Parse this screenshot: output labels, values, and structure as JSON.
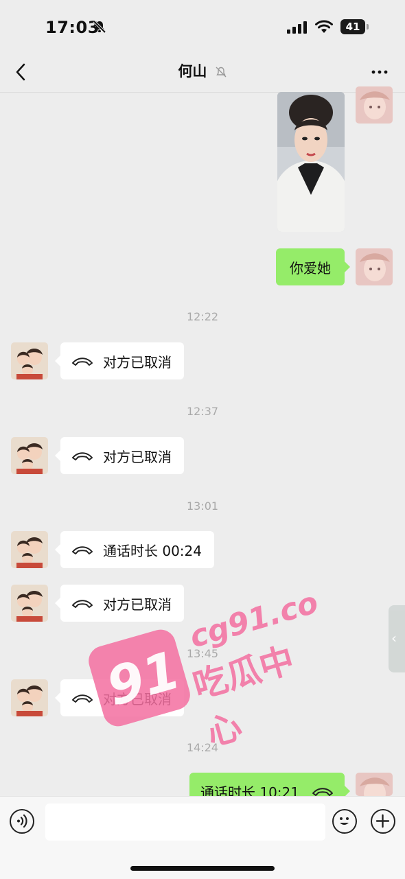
{
  "status_bar": {
    "time": "17:03",
    "battery": "41"
  },
  "header": {
    "title": "何山"
  },
  "messages": [
    {
      "side": "right",
      "type": "image"
    },
    {
      "side": "right",
      "type": "text",
      "text": "你爱她"
    },
    {
      "type": "timestamp",
      "text": "12:22"
    },
    {
      "side": "left",
      "type": "call",
      "text": "对方已取消"
    },
    {
      "type": "timestamp",
      "text": "12:37"
    },
    {
      "side": "left",
      "type": "call",
      "text": "对方已取消"
    },
    {
      "type": "timestamp",
      "text": "13:01"
    },
    {
      "side": "left",
      "type": "call",
      "text": "通话时长 00:24"
    },
    {
      "side": "left",
      "type": "call",
      "text": "对方已取消"
    },
    {
      "type": "timestamp",
      "text": "13:45"
    },
    {
      "side": "left",
      "type": "call",
      "text": "对方已取消"
    },
    {
      "type": "timestamp",
      "text": "14:24"
    },
    {
      "side": "right",
      "type": "call",
      "text": "通话时长 10:21"
    }
  ],
  "watermark": {
    "badge": "91",
    "url": "cg91.co",
    "name": "吃瓜中心"
  },
  "icons": {
    "back": "chevron-left-icon",
    "mute": "bell-off-icon",
    "more": "more-dots-icon",
    "call": "phone-hangup-icon",
    "voice": "voice-icon",
    "emoji": "emoji-icon",
    "plus": "plus-icon",
    "side_tab": "chevron-left-icon"
  },
  "colors": {
    "background": "#ededed",
    "bubble_self": "#95ec69",
    "bubble_other": "#ffffff",
    "watermark": "#f36fa0"
  }
}
